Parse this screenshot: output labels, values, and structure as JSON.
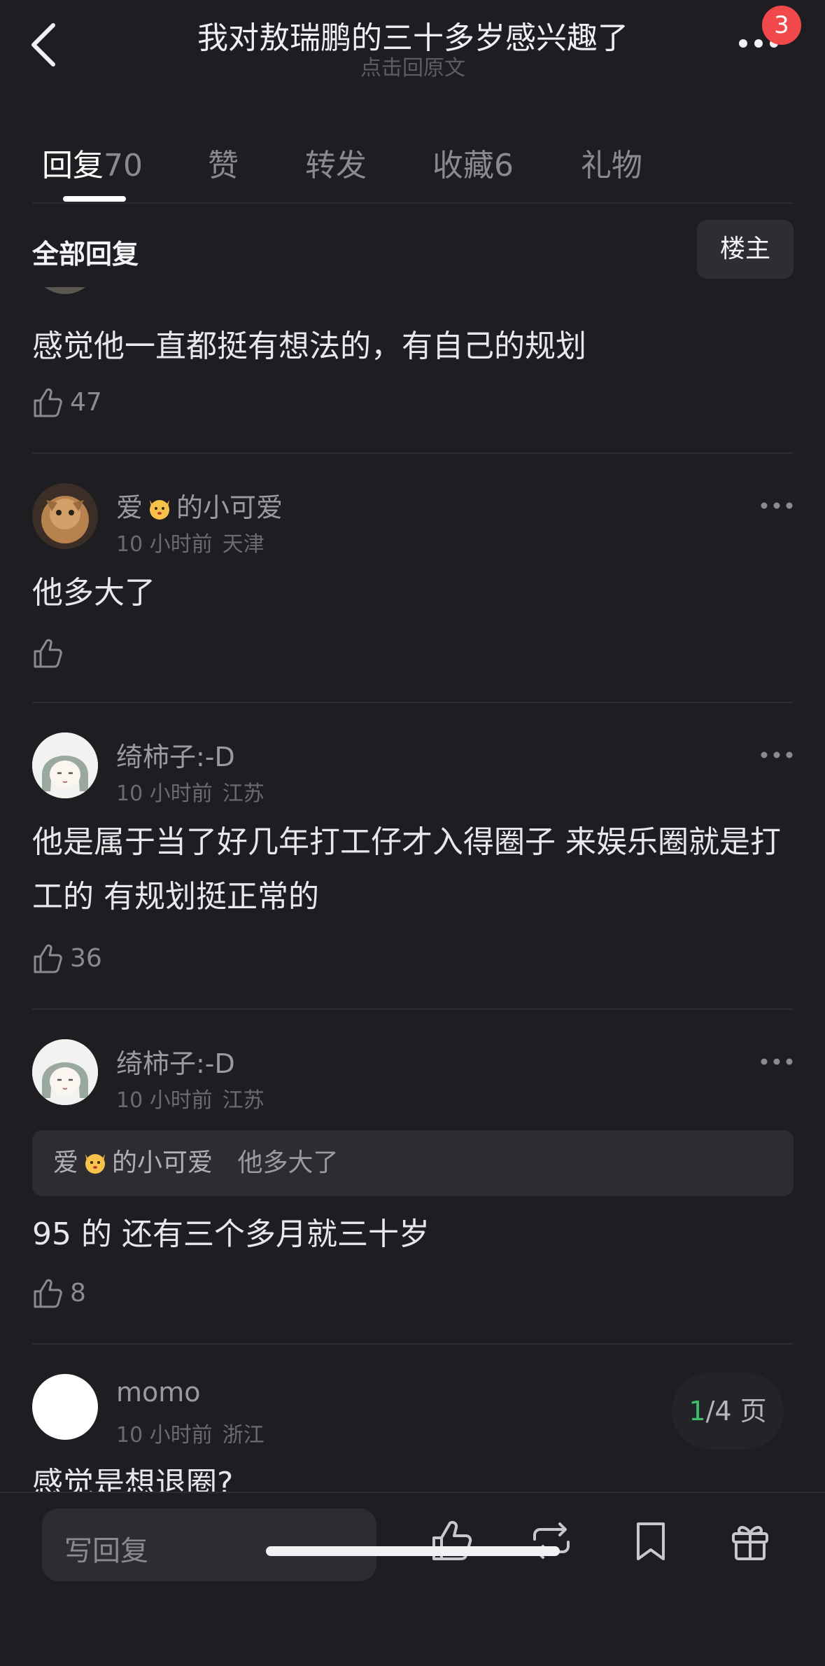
{
  "header": {
    "title": "我对敖瑞鹏的三十多岁感兴趣了",
    "subtitle": "点击回原文",
    "badge": "3"
  },
  "tabs": [
    {
      "label": "回复",
      "count": "70"
    },
    {
      "label": "赞",
      "count": ""
    },
    {
      "label": "转发",
      "count": ""
    },
    {
      "label": "收藏",
      "count": "6"
    },
    {
      "label": "礼物",
      "count": ""
    }
  ],
  "filter": {
    "label": "全部回复",
    "op_button": "楼主"
  },
  "comments": [
    {
      "text": "感觉他一直都挺有想法的，有自己的规划",
      "likes": "47"
    },
    {
      "user_prefix": "爱",
      "user_suffix": "的小可爱",
      "time": "10 小时前",
      "location": "天津",
      "text": "他多大了",
      "likes": ""
    },
    {
      "user": "绮柿子:-D",
      "time": "10 小时前",
      "location": "江苏",
      "text": "他是属于当了好几年打工仔才入得圈子 来娱乐圈就是打工的 有规划挺正常的",
      "likes": "36"
    },
    {
      "user": "绮柿子:-D",
      "time": "10 小时前",
      "location": "江苏",
      "quote_user_prefix": "爱",
      "quote_user_suffix": "的小可爱",
      "quote_text": "他多大了",
      "text": "95 的 还有三个多月就三十岁",
      "likes": "8"
    },
    {
      "user": "momo",
      "time": "10 小时前",
      "location": "浙江",
      "text": "感觉是想退圈?"
    }
  ],
  "pagination": {
    "current": "1",
    "total_text": "/4 页"
  },
  "bottom_bar": {
    "reply_placeholder": "写回复"
  },
  "colors": {
    "background": "#1e1e22",
    "badge": "#f0484b",
    "page_current": "#3bbf6b"
  }
}
